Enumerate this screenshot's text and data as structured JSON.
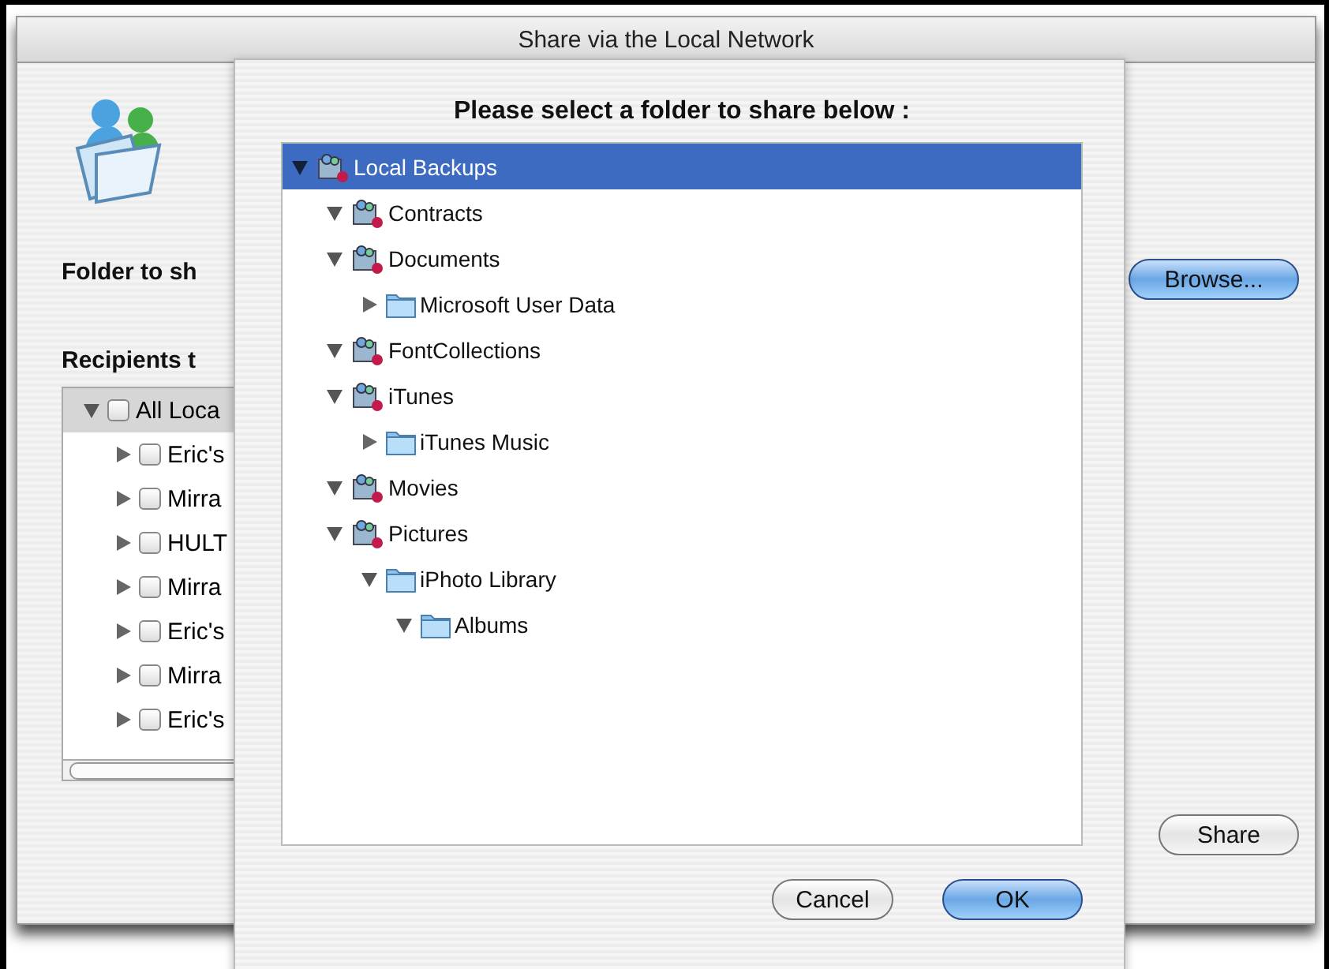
{
  "window": {
    "title": "Share via the Local Network"
  },
  "folder_label": "Folder to sh",
  "browse_button": "Browse...",
  "recipients_label": "Recipients t",
  "recipients": [
    {
      "label": "All Loca",
      "expanded": true,
      "checked": false,
      "selected": true,
      "children": [
        {
          "label": "Eric's",
          "expanded": false,
          "checked": false,
          "selected": false
        },
        {
          "label": "Mirra",
          "expanded": false,
          "checked": false,
          "selected": false
        },
        {
          "label": "HULT",
          "expanded": false,
          "checked": false,
          "selected": false
        },
        {
          "label": "Mirra",
          "expanded": false,
          "checked": false,
          "selected": false
        },
        {
          "label": "Eric's",
          "expanded": false,
          "checked": false,
          "selected": false
        },
        {
          "label": "Mirra",
          "expanded": false,
          "checked": false,
          "selected": false
        },
        {
          "label": "Eric's",
          "expanded": false,
          "checked": false,
          "selected": false
        }
      ]
    }
  ],
  "share_button": "Share",
  "sheet": {
    "title": "Please select a folder to share below :",
    "tree": [
      {
        "label": "Local Backups",
        "kind": "shared",
        "expanded": true,
        "selected": true,
        "children": [
          {
            "label": "Contracts",
            "kind": "shared",
            "expanded": true,
            "selected": false
          },
          {
            "label": "Documents",
            "kind": "shared",
            "expanded": true,
            "selected": false,
            "children": [
              {
                "label": "Microsoft User Data",
                "kind": "folder",
                "expanded": false,
                "selected": false
              }
            ]
          },
          {
            "label": "FontCollections",
            "kind": "shared",
            "expanded": true,
            "selected": false
          },
          {
            "label": "iTunes",
            "kind": "shared",
            "expanded": true,
            "selected": false,
            "children": [
              {
                "label": "iTunes Music",
                "kind": "folder",
                "expanded": false,
                "selected": false
              }
            ]
          },
          {
            "label": "Movies",
            "kind": "shared",
            "expanded": true,
            "selected": false
          },
          {
            "label": "Pictures",
            "kind": "shared",
            "expanded": true,
            "selected": false,
            "children": [
              {
                "label": "iPhoto Library",
                "kind": "folder",
                "expanded": true,
                "selected": false,
                "children": [
                  {
                    "label": "Albums",
                    "kind": "folder",
                    "expanded": true,
                    "selected": false
                  }
                ]
              }
            ]
          }
        ]
      }
    ],
    "buttons": [
      {
        "label": "Cancel",
        "kind": "normal"
      },
      {
        "label": "OK",
        "kind": "default"
      }
    ]
  }
}
